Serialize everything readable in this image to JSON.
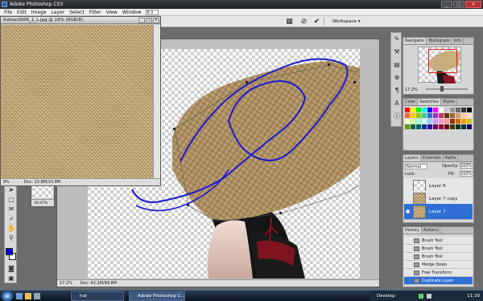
{
  "app": {
    "title": "Adobe Photoshop CS3"
  },
  "menu": [
    "File",
    "Edit",
    "Image",
    "Layer",
    "Select",
    "Filter",
    "View",
    "Window"
  ],
  "menu_zoom_value": "8.0",
  "optbar": {
    "workspace_label": "Workspace ▾"
  },
  "doc_texture": {
    "title": "Rattan0006_1_L.jpg @ 19% (RGB/8)",
    "zoom": "9%",
    "status": "Doc: 10.8M/10.8M"
  },
  "doc_mini": {
    "zoom": "18.97%"
  },
  "doc_main": {
    "zoom": "17.2%",
    "status": "Doc: 42.1M/99.8M"
  },
  "navigator": {
    "tabs": [
      "Navigator",
      "Histogram",
      "Info"
    ],
    "zoom": "17.2%"
  },
  "color_panel": {
    "tabs": [
      "Color",
      "Swatches",
      "Styles"
    ],
    "swatch_colors": [
      "#ff0000",
      "#ffff00",
      "#00ff00",
      "#00ffff",
      "#0000ff",
      "#ff00ff",
      "#ffffff",
      "#cccccc",
      "#999999",
      "#666666",
      "#333333",
      "#000000",
      "#ff6633",
      "#ffcc00",
      "#99cc00",
      "#33cc99",
      "#3366cc",
      "#9933cc",
      "#cc3366",
      "#663300",
      "#996633",
      "#cc9966",
      "#ffcc99",
      "#ffe0c0",
      "#ffffcc",
      "#ccff99",
      "#99ffcc",
      "#ccffff",
      "#99ccff",
      "#cc99ff",
      "#ff99cc",
      "#ff9999",
      "#993300",
      "#cc6600",
      "#ff9900",
      "#cccc00",
      "#669900",
      "#006633",
      "#006666",
      "#003399",
      "#330099",
      "#660066",
      "#990033",
      "#660000",
      "#333300",
      "#003300",
      "#003333",
      "#000066"
    ]
  },
  "layers_panel": {
    "tabs": [
      "Layers",
      "Channels",
      "Paths"
    ],
    "blend_mode": "Normal",
    "opacity_label": "Opacity:",
    "opacity_value": "100%",
    "lock_label": "Lock:",
    "fill_label": "Fill:",
    "fill_value": "100%",
    "layers": [
      {
        "name": "Layer 6",
        "selected": false
      },
      {
        "name": "Layer 7 copy",
        "selected": false
      },
      {
        "name": "Layer 7",
        "selected": true
      }
    ]
  },
  "history_panel": {
    "tabs": [
      "History",
      "Actions"
    ],
    "items": [
      {
        "label": "Brush Tool",
        "selected": false
      },
      {
        "label": "Brush Tool",
        "selected": false
      },
      {
        "label": "Brush Tool",
        "selected": false
      },
      {
        "label": "Merge Down",
        "selected": false
      },
      {
        "label": "Free Transform",
        "selected": false
      },
      {
        "label": "Duplicate Layer",
        "selected": true
      }
    ]
  },
  "foreground_color": "#0000cc",
  "background_color": "#ffffff",
  "accent_color": "#2f6fd6",
  "taskbar": {
    "buttons": [
      "hat",
      "Adobe Photoshop C..."
    ],
    "desktop_label": "Desktop",
    "time": "11:39"
  }
}
